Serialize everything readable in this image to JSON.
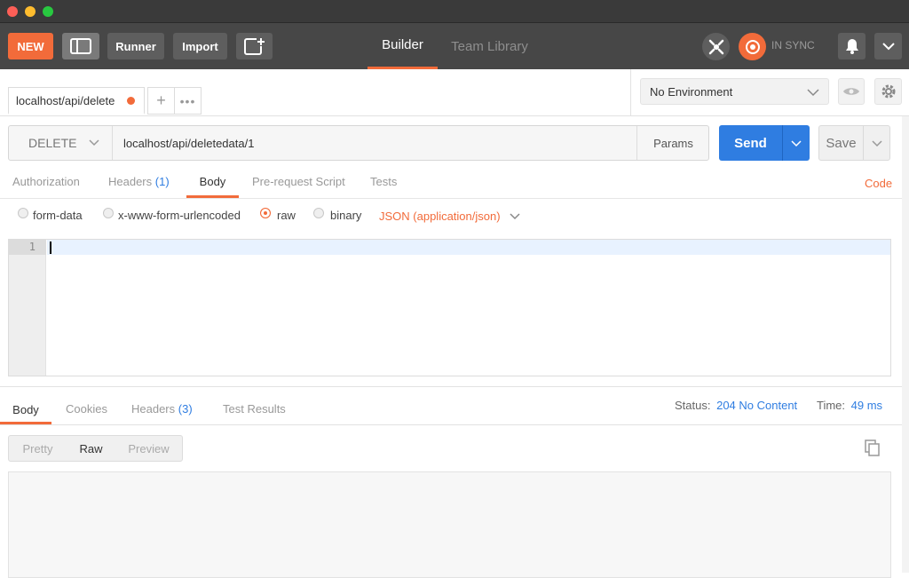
{
  "window": {
    "traffic_colors": [
      "#fd5f57",
      "#febc2e",
      "#28c840"
    ]
  },
  "toolbar": {
    "new_label": "NEW",
    "runner_label": "Runner",
    "import_label": "Import",
    "nav_tabs": [
      {
        "label": "Builder",
        "active": true
      },
      {
        "label": "Team Library",
        "active": false
      }
    ],
    "sync_label": "IN SYNC"
  },
  "request_tab": {
    "label": "localhost/api/delete"
  },
  "environment": {
    "selected": "No Environment"
  },
  "request": {
    "method": "DELETE",
    "url": "localhost/api/deletedata/1",
    "params_label": "Params",
    "send_label": "Send",
    "save_label": "Save"
  },
  "request_tabs": [
    {
      "label": "Authorization"
    },
    {
      "label": "Headers",
      "count": "(1)"
    },
    {
      "label": "Body",
      "active": true
    },
    {
      "label": "Pre-request Script"
    },
    {
      "label": "Tests"
    }
  ],
  "code_link": "Code",
  "body_modes": [
    "form-data",
    "x-www-form-urlencoded",
    "raw",
    "binary"
  ],
  "body_selected": "raw",
  "content_type": "JSON (application/json)",
  "editor": {
    "line_numbers": [
      "1"
    ]
  },
  "response": {
    "tabs": [
      {
        "label": "Body",
        "active": true
      },
      {
        "label": "Cookies"
      },
      {
        "label": "Headers",
        "count": "(3)"
      },
      {
        "label": "Test Results"
      }
    ],
    "status_label": "Status:",
    "status_value": "204 No Content",
    "time_label": "Time:",
    "time_value": "49 ms",
    "view_modes": [
      {
        "label": "Pretty"
      },
      {
        "label": "Raw",
        "active": true
      },
      {
        "label": "Preview"
      }
    ]
  },
  "colors": {
    "accent": "#f26b3a",
    "blue": "#2f7de1",
    "toolbar": "#474747"
  }
}
